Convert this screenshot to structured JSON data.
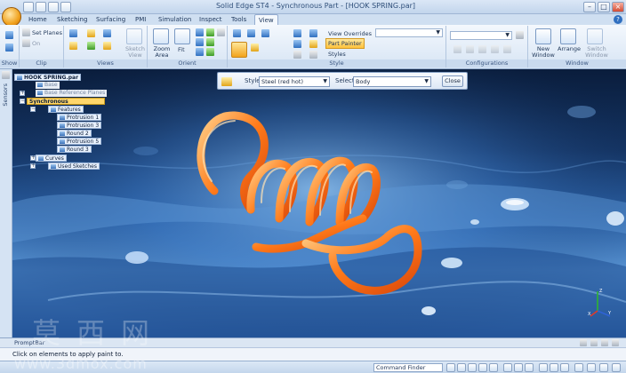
{
  "window": {
    "title": "Solid Edge ST4 - Synchronous Part - [HOOK SPRING.par]"
  },
  "tabs": [
    "Home",
    "Sketching",
    "Surfacing",
    "PMI",
    "Simulation",
    "Inspect",
    "Tools",
    "View"
  ],
  "active_tab": "View",
  "ribbon": {
    "show_group": {
      "label": "Show"
    },
    "clip_group": {
      "label": "Clip",
      "set_planes": "Set Planes",
      "on": "On"
    },
    "views_group": {
      "label": "Views",
      "sketch_view": "Sketch View"
    },
    "orient_group": {
      "label": "Orient",
      "zoom_area": "Zoom Area",
      "fit": "Fit"
    },
    "style_group": {
      "label": "Style",
      "view_overrides": "View Overrides",
      "part_painter": "Part Painter",
      "styles": "Styles"
    },
    "configurations_group": {
      "label": "Configurations"
    },
    "window_group": {
      "label": "Window",
      "new_window": "New Window",
      "arrange": "Arrange",
      "switch_window": "Switch Window"
    }
  },
  "sidebar": {
    "label": "Sensors"
  },
  "command_bar": {
    "style_label": "Style:",
    "style_value": "Steel (red hot)",
    "select_label": "Select:",
    "select_value": "Body",
    "close_label": "Close"
  },
  "tree": {
    "root": "HOOK SPRING.par",
    "items": [
      "Base",
      "Base Reference Planes",
      "Synchronous",
      "Features",
      "Protrusion 1",
      "Protrusion 3",
      "Round 2",
      "Protrusion 5",
      "Round 3",
      "Curves",
      "Used Sketches"
    ]
  },
  "prompt": {
    "title": "PromptBar",
    "message": "Click on elements to apply paint to."
  },
  "status": {
    "command_finder": "Command Finder"
  },
  "watermark": {
    "chars": "莫西网",
    "url": "www.3dmox.com"
  },
  "triad": {
    "x": "X",
    "y": "Y",
    "z": "Z"
  },
  "colors": {
    "coil": "#ff7a1a",
    "accent": "#f2a31b"
  }
}
